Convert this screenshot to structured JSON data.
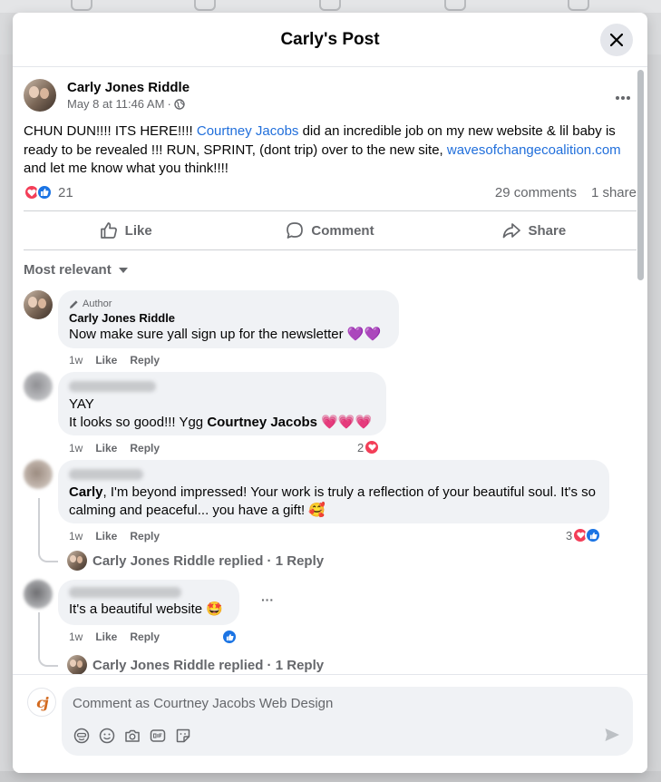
{
  "modal": {
    "title": "Carly's Post"
  },
  "post": {
    "author": "Carly Jones Riddle",
    "timestamp": "May 8 at 11:46 AM",
    "dot": "·",
    "body_part1": "CHUN DUN!!!! ITS HERE!!!! ",
    "mention": "Courtney Jacobs",
    "body_part2": " did an incredible job on my new website & lil baby is ready to be revealed !!! RUN, SPRINT, (dont trip) over to the new site, ",
    "link": "wavesofchangecoalition.com",
    "body_part3": " and let me know what you think!!!!",
    "reaction_count": "21",
    "comments_count": "29 comments",
    "shares_count": "1 share"
  },
  "actions": {
    "like": "Like",
    "comment": "Comment",
    "share": "Share"
  },
  "sort_label": "Most relevant",
  "comments": [
    {
      "badge": "Author",
      "name": "Carly Jones Riddle",
      "text": "Now make sure yall sign up for the newsletter 💜💜",
      "time": "1w",
      "like": "Like",
      "reply": "Reply"
    },
    {
      "line1": "YAY",
      "text_before": "It looks so good!!! Ygg ",
      "mention": "Courtney Jacobs",
      "text_after": " 💗💗💗",
      "time": "1w",
      "like": "Like",
      "reply": "Reply",
      "reactions": "2"
    },
    {
      "mention": "Carly",
      "text": ", I'm beyond impressed! Your work is truly a reflection of your beautiful soul. It's so calming and peaceful... you have a gift! 🥰",
      "time": "1w",
      "like": "Like",
      "reply": "Reply",
      "reactions": "3",
      "replied": "Carly Jones Riddle replied · 1 Reply"
    },
    {
      "text": "It's a beautiful website 🤩",
      "more": "···",
      "time": "1w",
      "like": "Like",
      "reply": "Reply",
      "replied": "Carly Jones Riddle replied · 1 Reply"
    }
  ],
  "composer": {
    "placeholder": "Comment as Courtney Jacobs Web Design",
    "avatar_text": "cj"
  },
  "colors": {
    "link": "#216fdb",
    "love": "#f33e58",
    "like": "#1b74e4",
    "secondary_text": "#65676b",
    "bubble": "#f0f2f5"
  }
}
